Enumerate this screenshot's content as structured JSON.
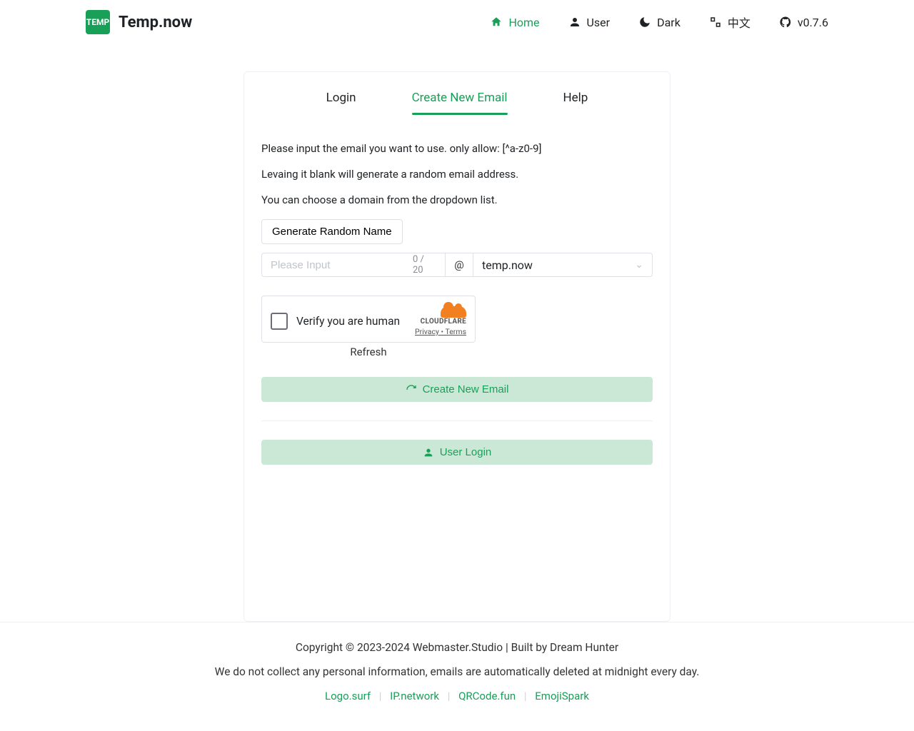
{
  "brand": {
    "logo_text": "TEMP",
    "name": "Temp.now"
  },
  "nav": {
    "home": "Home",
    "user": "User",
    "dark": "Dark",
    "lang": "中文",
    "version": "v0.7.6"
  },
  "tabs": {
    "login": "Login",
    "create": "Create New Email",
    "help": "Help"
  },
  "instr": {
    "line1": "Please input the email you want to use. only allow: [^a-z0-9]",
    "line2": "Levaing it blank will generate a random email address.",
    "line3": "You can choose a domain from the dropdown list."
  },
  "form": {
    "generate_btn": "Generate Random Name",
    "placeholder": "Please Input",
    "counter": "0 / 20",
    "at": "@",
    "domain": "temp.now"
  },
  "turnstile": {
    "label": "Verify you are human",
    "brand": "CLOUDFLARE",
    "privacy": "Privacy",
    "dot": " • ",
    "terms": "Terms",
    "refresh": "Refresh"
  },
  "actions": {
    "create": "Create New Email",
    "login": "User Login"
  },
  "footer": {
    "copyright": "Copyright © 2023-2024 Webmaster.Studio | Built by Dream Hunter",
    "disclaimer": "We do not collect any personal information, emails are automatically deleted at midnight every day.",
    "links": {
      "logo_surf": "Logo.surf",
      "ip_network": "IP.network",
      "qrcode_fun": "QRCode.fun",
      "emojispark": "EmojiSpark"
    }
  }
}
